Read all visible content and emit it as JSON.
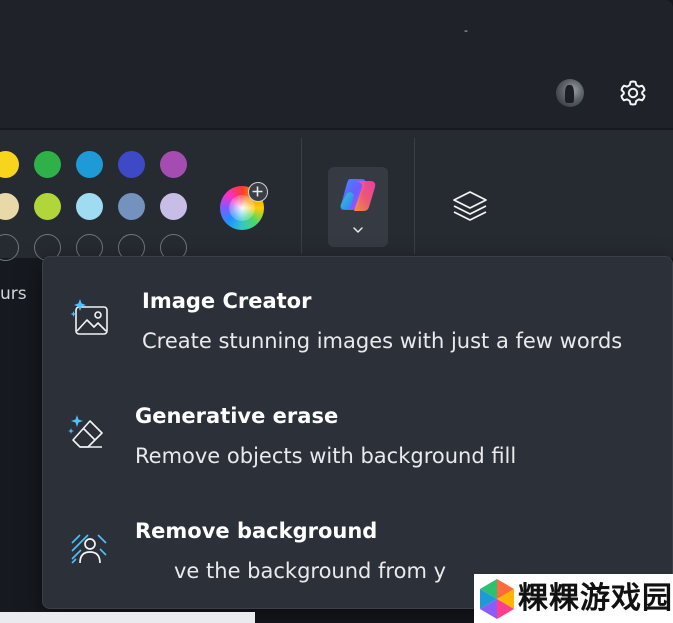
{
  "titlebar": {
    "minimize_glyph": "-",
    "avatar_icon": "user-avatar",
    "settings_icon": "gear-icon"
  },
  "toolbar": {
    "colours_label": "urs",
    "swatch_rows": [
      [
        "#f7d51d",
        "#2fb14a",
        "#1e9ad6",
        "#3e49c8",
        "#a54cb0"
      ],
      [
        "#ead9a8",
        "#b0d63a",
        "#9fdcf1",
        "#7392be",
        "#c8bde6"
      ],
      [
        "empty",
        "empty",
        "empty",
        "empty",
        "empty"
      ]
    ],
    "color_wheel_icon": "color-wheel-add-icon",
    "copilot_icon": "copilot-icon",
    "copilot_dropdown_icon": "chevron-down-icon",
    "layers_icon": "layers-icon"
  },
  "menu": {
    "items": [
      {
        "title": "Image Creator",
        "description": "Create stunning images with just a few words",
        "icon": "image-sparkle-icon"
      },
      {
        "title": "Generative erase",
        "description": "Remove objects with background fill",
        "icon": "eraser-sparkle-icon"
      },
      {
        "title": "Remove background",
        "description": "ve the background from y",
        "icon": "remove-background-icon"
      }
    ]
  },
  "watermark": {
    "text": "粿粿游戏园"
  },
  "colors": {
    "accent": "#60cdff",
    "menu_bg": "#2c3038",
    "toolbar_bg": "#262a31"
  }
}
